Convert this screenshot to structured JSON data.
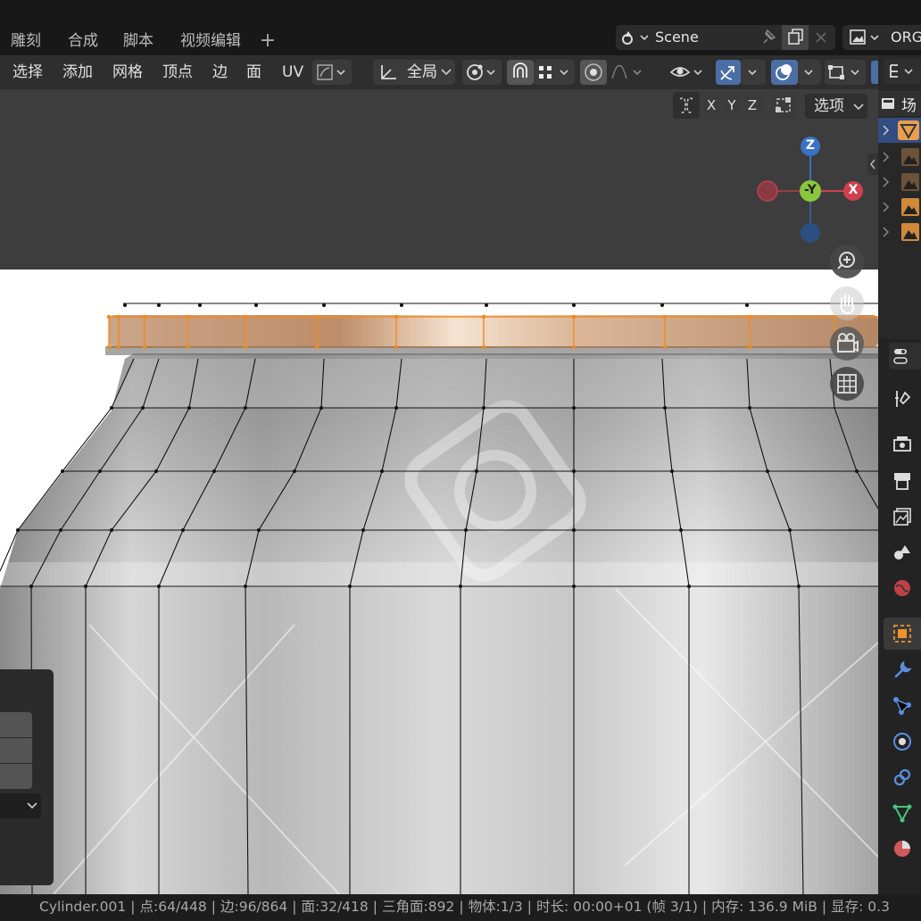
{
  "workspace_tabs": [
    "雕刻",
    "合成",
    "脚本",
    "视频编辑"
  ],
  "scene": {
    "name": "Scene",
    "view_layer": "ORG"
  },
  "header": {
    "menus": [
      "选择",
      "添加",
      "网格",
      "顶点",
      "边",
      "面",
      "UV"
    ],
    "transform_orientation": "全局",
    "axis_buttons": [
      "X",
      "Y",
      "Z"
    ],
    "options_label": "选项"
  },
  "gizmo": {
    "z": "Z",
    "y": "-Y",
    "x": "X",
    "colors": {
      "z": "#3a72c5",
      "y": "#8ac73d",
      "x": "#d0404f"
    }
  },
  "outliner": {
    "title_partial": "场"
  },
  "accent": "#f0922c",
  "statusbar": {
    "object": "Cylinder.001",
    "verts": "点:64/448",
    "edges": "边:96/864",
    "faces": "面:32/418",
    "tris": "三角面:892",
    "objects": "物体:1/3",
    "time": "时长: 00:00+01 (帧 3/1)",
    "memory": "内存: 136.9 MiB",
    "vram": "显存: 0.3"
  },
  "icons": [
    "pin-icon",
    "copy-icon",
    "close-icon",
    "image-icon",
    "transform-pivot-icon",
    "snap-icon",
    "proportional-icon",
    "visibility-icon",
    "gizmo-icon",
    "overlay-icon",
    "xray-icon",
    "zoom-icon",
    "hand-icon",
    "camera-icon",
    "grid-icon",
    "tool-icon",
    "render-icon",
    "output-icon",
    "view-layer-icon",
    "scene-icon",
    "world-icon",
    "object-icon",
    "modifier-icon",
    "particles-icon",
    "physics-icon",
    "constraints-icon",
    "data-icon",
    "material-icon"
  ]
}
